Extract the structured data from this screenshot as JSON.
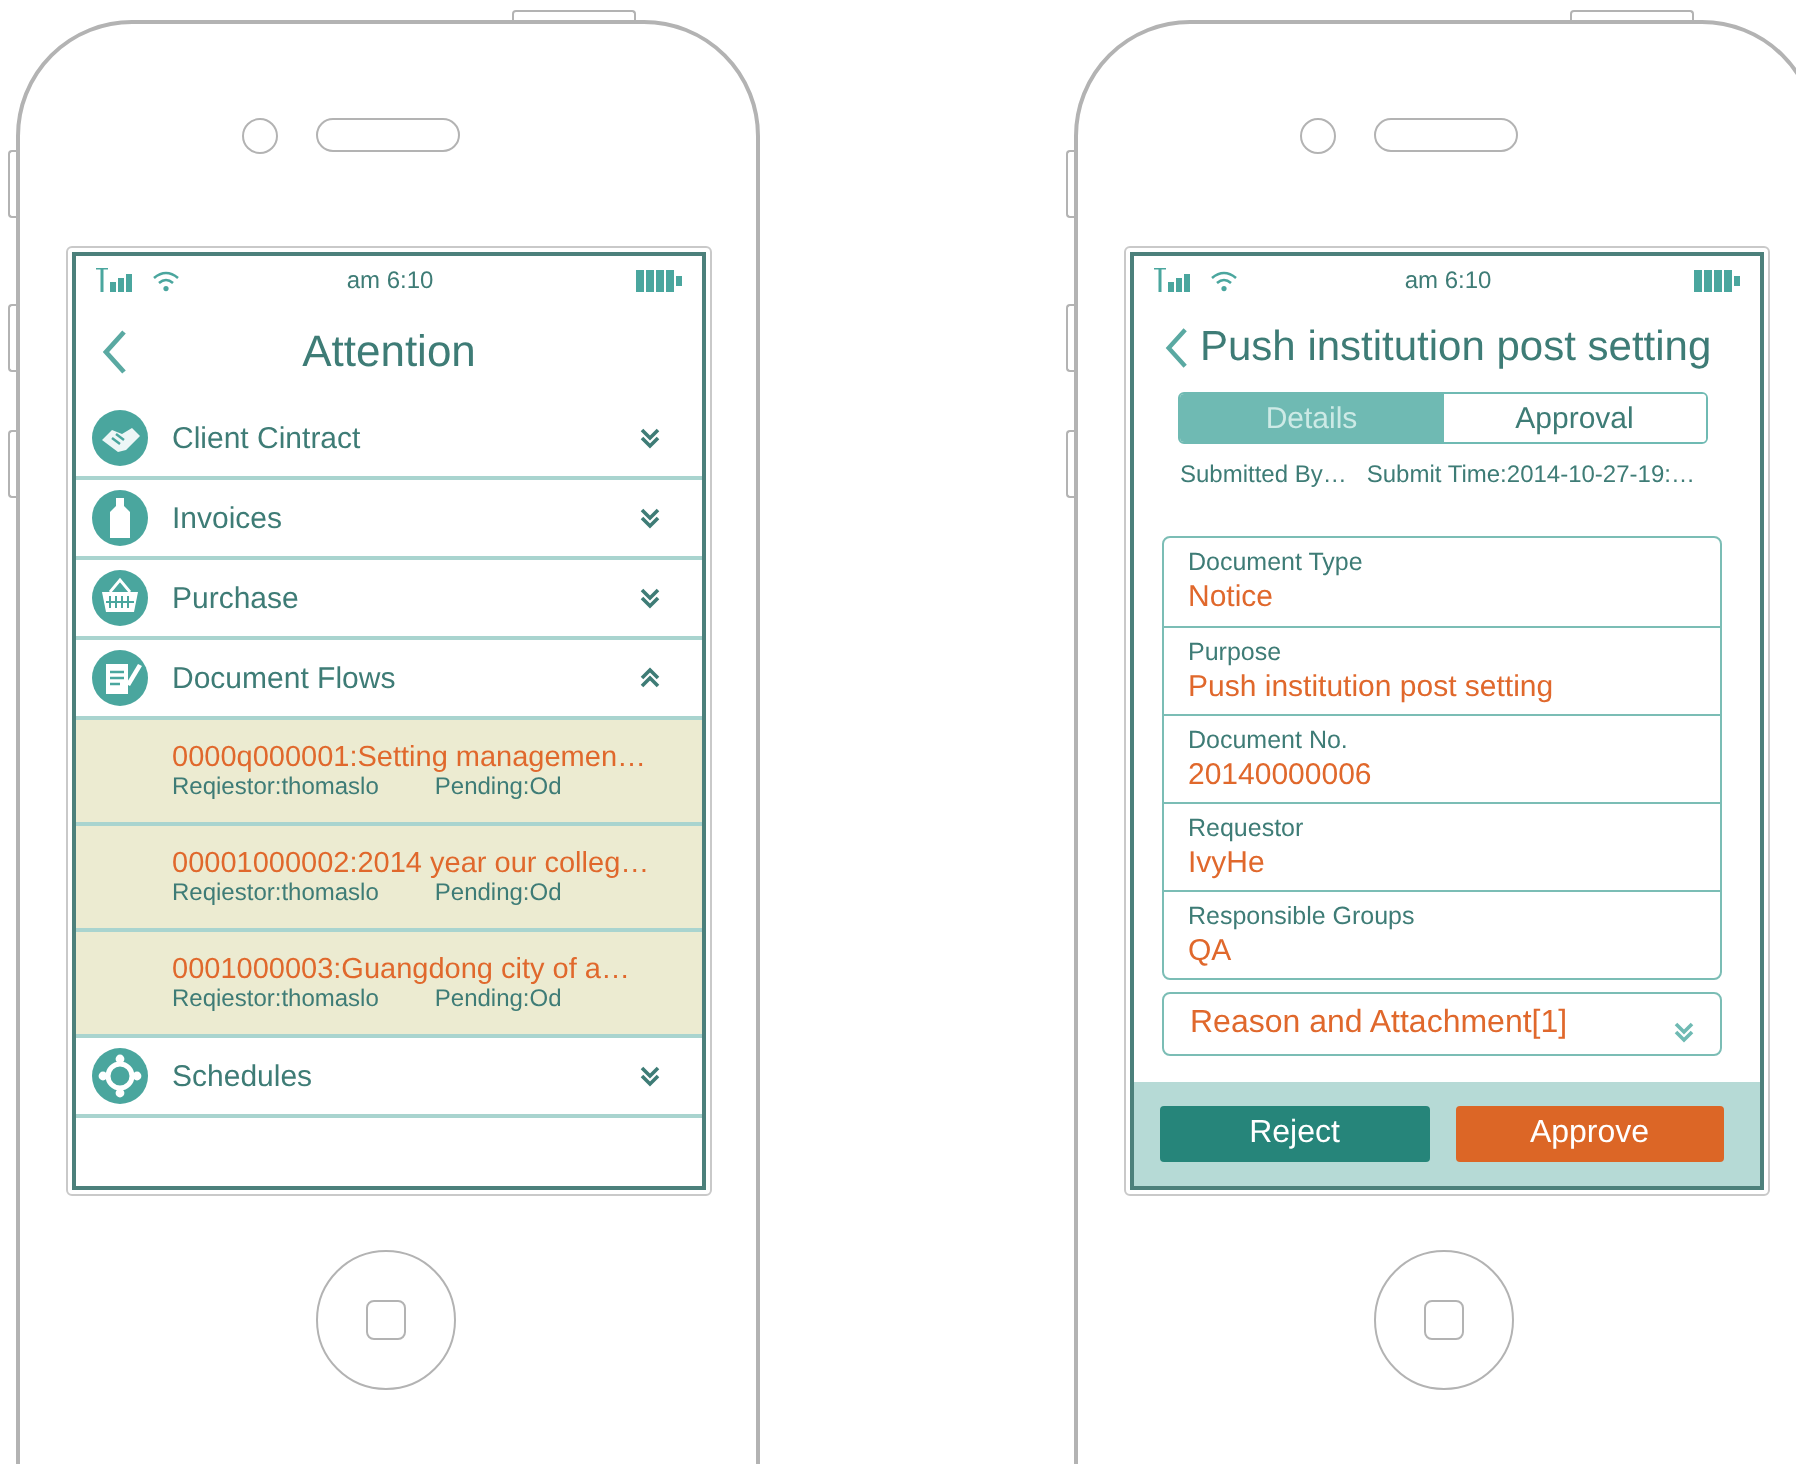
{
  "phones": [
    {
      "kind": "list",
      "time": "am 6:10",
      "title": "Attention",
      "sections": [
        {
          "label": "Client Cintract",
          "expanded": false
        },
        {
          "label": "Invoices",
          "expanded": false
        },
        {
          "label": "Purchase",
          "expanded": false
        },
        {
          "label": "Document Flows",
          "expanded": true,
          "items": [
            {
              "title": "0000q000001:Setting managemen…",
              "requestor": "Reqiestor:thomaslo",
              "pending": "Pending:Od"
            },
            {
              "title": "00001000002:2014 year our colleg…",
              "requestor": "Reqiestor:thomaslo",
              "pending": "Pending:Od"
            },
            {
              "title": "0001000003:Guangdong city of a…",
              "requestor": "Reqiestor:thomaslo",
              "pending": "Pending:Od"
            }
          ]
        },
        {
          "label": "Schedules",
          "expanded": false
        }
      ]
    },
    {
      "kind": "detail",
      "time": "am 6:10",
      "title": "Push institution post setting",
      "tabs": [
        {
          "label": "Details",
          "selected": true
        },
        {
          "label": "Approval",
          "selected": false
        }
      ],
      "submitted_by": "Submitted By…",
      "submit_time": "Submit Time:2014-10-27-19:…",
      "fields": [
        {
          "label": "Document Type",
          "value": "Notice"
        },
        {
          "label": "Purpose",
          "value": "Push institution post setting"
        },
        {
          "label": "Document No.",
          "value": "20140000006"
        },
        {
          "label": "Requestor",
          "value": "IvyHe"
        },
        {
          "label": "Responsible Groups",
          "value": "QA"
        }
      ],
      "reason": {
        "label": "Reason and Attachment[1]",
        "expanded": false
      },
      "buttons": [
        {
          "label": "Reject",
          "kind": "reject"
        },
        {
          "label": "Approve",
          "kind": "approve"
        }
      ]
    }
  ]
}
